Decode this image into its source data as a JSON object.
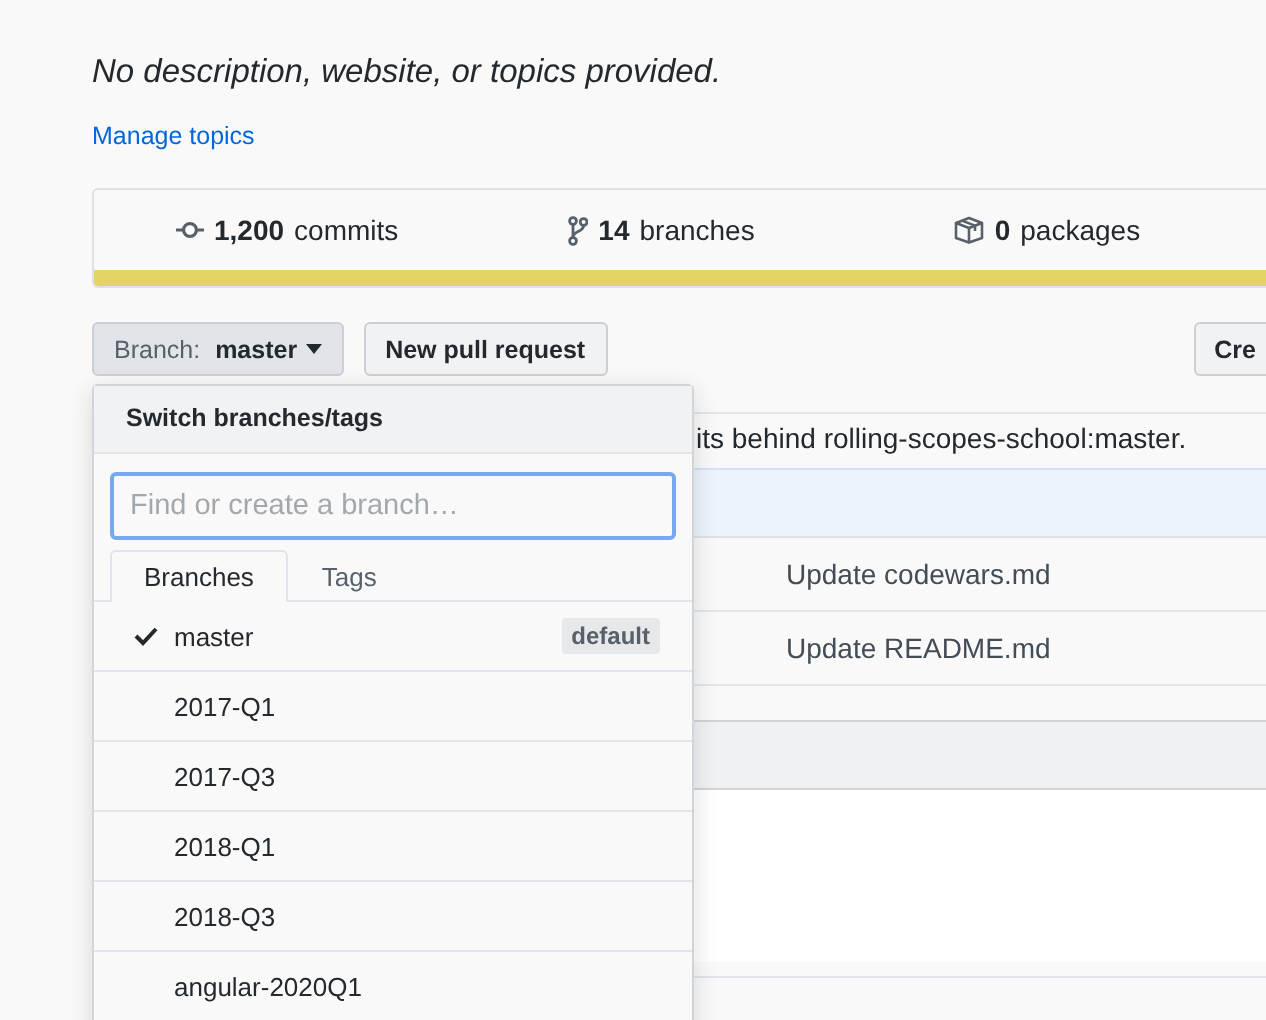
{
  "description": "No description, website, or topics provided.",
  "manage_topics": "Manage topics",
  "stats": [
    {
      "kind": "commits",
      "count": "1,200",
      "label": "commits"
    },
    {
      "kind": "branches",
      "count": "14",
      "label": "branches"
    },
    {
      "kind": "packages",
      "count": "0",
      "label": "packages"
    }
  ],
  "branch_select": {
    "prefix": "Branch:",
    "value": "master"
  },
  "new_pull_request": "New pull request",
  "create_button": "Cre",
  "repo_box": {
    "notice": "its behind rolling-scopes-school:master.",
    "files": [
      {
        "message": "Update codewars.md"
      },
      {
        "message": "Update README.md"
      }
    ]
  },
  "branch_menu": {
    "title": "Switch branches/tags",
    "placeholder": "Find or create a branch…",
    "tabs": [
      {
        "label": "Branches",
        "selected": true
      },
      {
        "label": "Tags",
        "selected": false
      }
    ],
    "branches": [
      {
        "name": "master",
        "checked": true,
        "badge": "default"
      },
      {
        "name": "2017-Q1",
        "checked": false
      },
      {
        "name": "2017-Q3",
        "checked": false
      },
      {
        "name": "2018-Q1",
        "checked": false
      },
      {
        "name": "2018-Q3",
        "checked": false
      },
      {
        "name": "angular-2020Q1",
        "checked": false
      }
    ]
  }
}
